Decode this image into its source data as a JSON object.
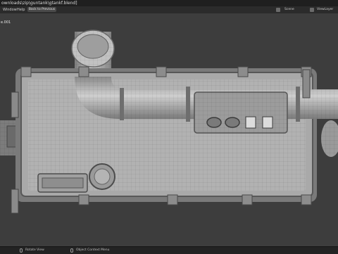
{
  "window": {
    "title": "ownloads\\zip\\guntank\\gtankf.blend]"
  },
  "menubar": {
    "items": [
      "Window",
      "Help"
    ],
    "back_button": "Back to Previous",
    "scene": "Scene",
    "view_layer": "ViewLayer"
  },
  "viewport": {
    "object_label": "e.001"
  },
  "statusbar": {
    "rotate_view": "Rotate View",
    "object_context_menu": "Object Context Menu"
  }
}
